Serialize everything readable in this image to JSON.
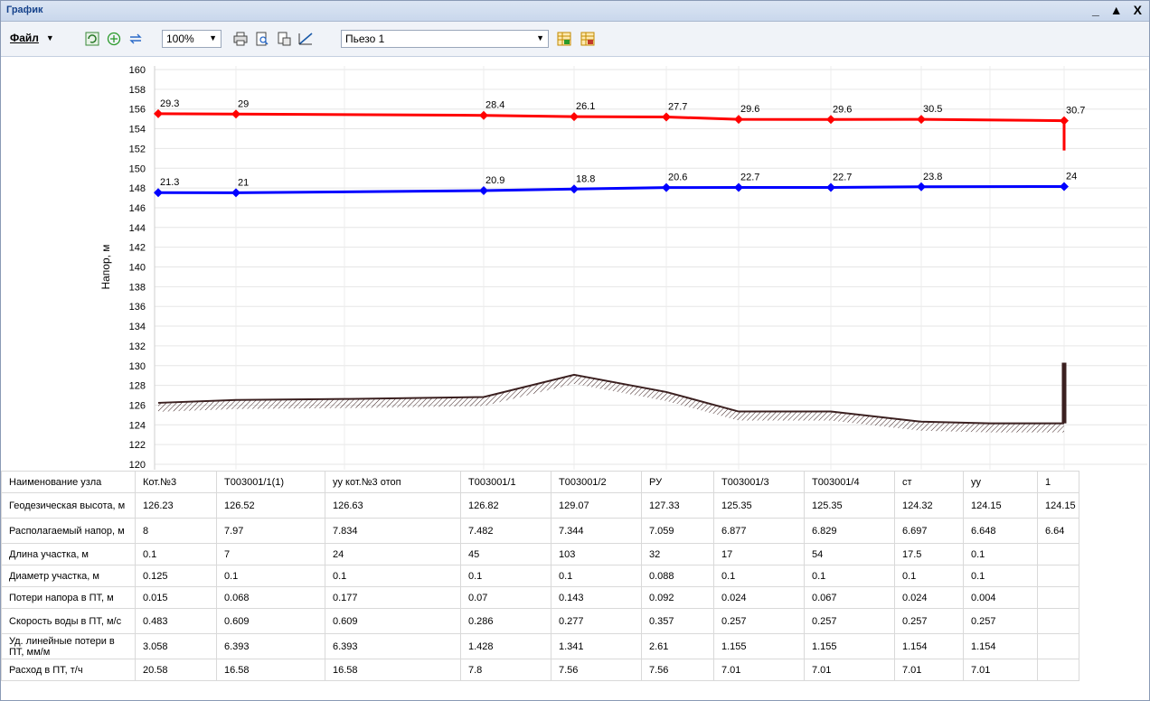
{
  "window": {
    "title": "График",
    "minimize": "_",
    "maximize": "▲",
    "close": "X"
  },
  "toolbar": {
    "file_menu": "Файл",
    "zoom": "100%",
    "profile": "Пьезо 1"
  },
  "chart_data": {
    "type": "line",
    "ylabel": "Напор, м",
    "ylim": [
      120,
      160
    ],
    "yticks": [
      120,
      122,
      124,
      126,
      128,
      130,
      132,
      134,
      136,
      138,
      140,
      142,
      144,
      146,
      148,
      150,
      152,
      154,
      156,
      158,
      160
    ],
    "x": [
      0,
      0.1,
      7.1,
      31.1,
      76.1,
      179.1,
      211.1,
      228.1,
      282.1,
      299.6,
      299.7
    ],
    "series": [
      {
        "name": "",
        "color": "#ff0000",
        "values": [
          155.53,
          155.49,
          155.36,
          155.23,
          155.2,
          154.95,
          154.94,
          154.95,
          154.82,
          154.82,
          154.85
        ],
        "labels": [
          "29.3",
          "29",
          "28.4",
          "26.1",
          "27.7",
          "29.6",
          "29.6",
          "30.5",
          "30.7"
        ]
      },
      {
        "name": "",
        "color": "#0000ff",
        "values": [
          147.53,
          147.52,
          147.73,
          147.89,
          148.04,
          148.05,
          148.06,
          148.12,
          148.15,
          148.15
        ],
        "labels": [
          "21.3",
          "21",
          "20.9",
          "18.8",
          "20.6",
          "22.7",
          "22.7",
          "23.8",
          "24"
        ]
      },
      {
        "name": "",
        "color": "#3b2020",
        "values": [
          126.23,
          126.52,
          126.63,
          126.82,
          129.07,
          127.33,
          125.35,
          125.35,
          124.32,
          124.15,
          124.15
        ]
      }
    ]
  },
  "table": {
    "rows": [
      {
        "header": "Наименование узла",
        "cells": [
          "Кот.№3",
          "Т003001/1(1)",
          "уу кот.№3 отоп",
          "Т003001/1",
          "Т003001/2",
          "РУ",
          "Т003001/3",
          "Т003001/4",
          "ст",
          "уу",
          "1"
        ]
      },
      {
        "header": "Геодезическая высота, м",
        "cells": [
          "126.23",
          "126.52",
          "126.63",
          "126.82",
          "129.07",
          "127.33",
          "125.35",
          "125.35",
          "124.32",
          "124.15",
          "124.15"
        ]
      },
      {
        "header": "Располагаемый напор, м",
        "cells": [
          "8",
          "7.97",
          "7.834",
          "7.482",
          "7.344",
          "7.059",
          "6.877",
          "6.829",
          "6.697",
          "6.648",
          "6.64"
        ]
      },
      {
        "header": "Длина участка, м",
        "cells": [
          "0.1",
          "7",
          "24",
          "45",
          "103",
          "32",
          "17",
          "54",
          "17.5",
          "0.1",
          ""
        ]
      },
      {
        "header": "Диаметр участка, м",
        "cells": [
          "0.125",
          "0.1",
          "0.1",
          "0.1",
          "0.1",
          "0.088",
          "0.1",
          "0.1",
          "0.1",
          "0.1",
          ""
        ]
      },
      {
        "header": "Потери напора в ПТ, м",
        "cells": [
          "0.015",
          "0.068",
          "0.177",
          "0.07",
          "0.143",
          "0.092",
          "0.024",
          "0.067",
          "0.024",
          "0.004",
          ""
        ]
      },
      {
        "header": "Скорость воды в ПТ, м/с",
        "cells": [
          "0.483",
          "0.609",
          "0.609",
          "0.286",
          "0.277",
          "0.357",
          "0.257",
          "0.257",
          "0.257",
          "0.257",
          ""
        ]
      },
      {
        "header": "Уд. линейные потери в ПТ, мм/м",
        "cells": [
          "3.058",
          "6.393",
          "6.393",
          "1.428",
          "1.341",
          "2.61",
          "1.155",
          "1.155",
          "1.154",
          "1.154",
          ""
        ]
      },
      {
        "header": "Расход в ПТ, т/ч",
        "cells": [
          "20.58",
          "16.58",
          "16.58",
          "7.8",
          "7.56",
          "7.56",
          "7.01",
          "7.01",
          "7.01",
          "7.01",
          ""
        ]
      }
    ]
  }
}
